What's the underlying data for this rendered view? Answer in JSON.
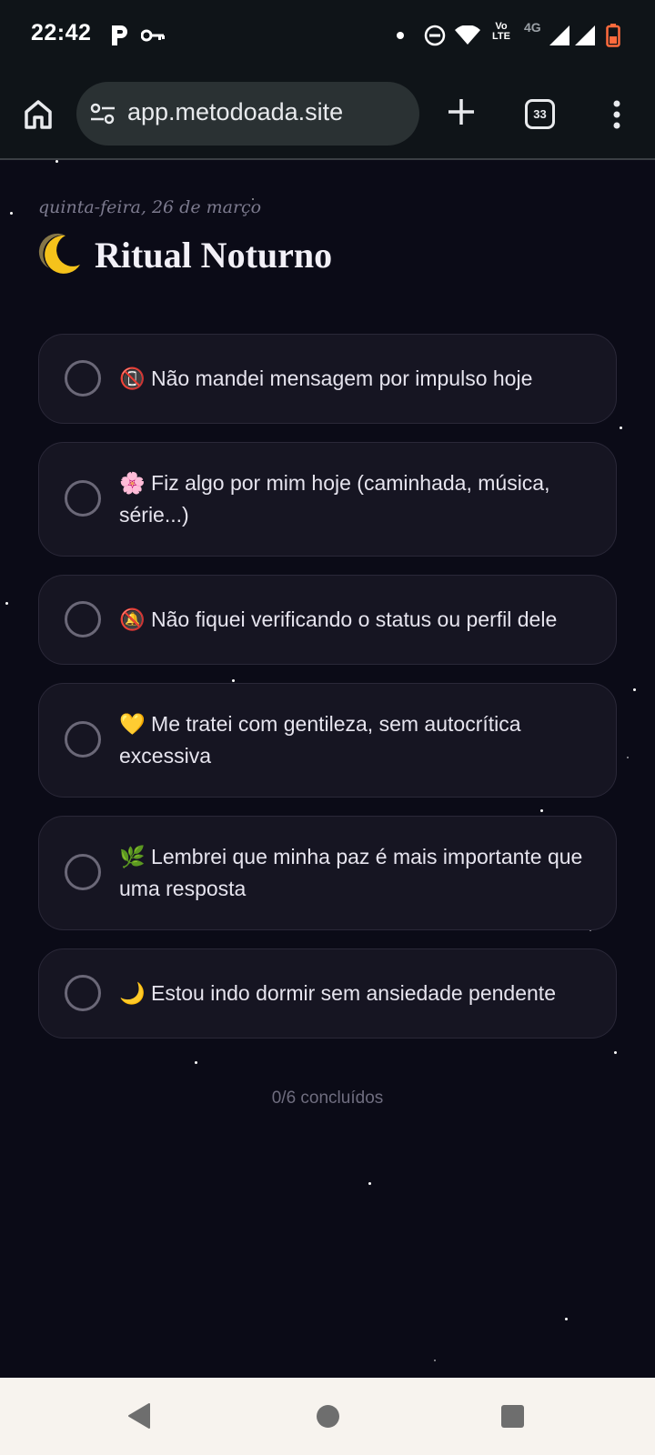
{
  "status_bar": {
    "time": "22:42",
    "lte_label": "Vo LTE",
    "network_label": "4G",
    "icons": [
      "parking-app-icon",
      "key-icon",
      "dot-icon",
      "do-not-disturb-icon",
      "wifi-icon",
      "signal-icon",
      "signal-icon",
      "battery-low-icon"
    ]
  },
  "browser": {
    "url": "app.metodoada.site",
    "tab_count": "33",
    "icons": [
      "home-icon",
      "site-settings-icon",
      "plus-icon",
      "tabs-icon",
      "more-vert-icon"
    ]
  },
  "page": {
    "date": "quinta-feira, 26 de março",
    "title_emoji": "crescent-moon-emoji",
    "title": "Ritual Noturno",
    "items": [
      {
        "emoji": "📵",
        "text": "Não mandei mensagem por impulso hoje",
        "checked": false
      },
      {
        "emoji": "🌸",
        "text": "Fiz algo por mim hoje (caminhada, música, série...)",
        "checked": false
      },
      {
        "emoji": "🔕",
        "text": "Não fiquei verificando o status ou perfil dele",
        "checked": false
      },
      {
        "emoji": "💛",
        "text": "Me tratei com gentileza, sem autocrítica excessiva",
        "checked": false
      },
      {
        "emoji": "🌿",
        "text": "Lembrei que minha paz é mais importante que uma resposta",
        "checked": false
      },
      {
        "emoji": "🌙",
        "text": "Estou indo dormir sem ansiedade pendente",
        "checked": false
      }
    ],
    "progress": "0/6 concluídos"
  },
  "colors": {
    "background": "#0b0b17",
    "card": "#161522",
    "card_border": "#2a2838",
    "text": "#e6e4ee",
    "muted": "#6f6d7f"
  },
  "nav_bar": {
    "icons": [
      "back-icon",
      "home-circle-icon",
      "recents-icon"
    ]
  }
}
